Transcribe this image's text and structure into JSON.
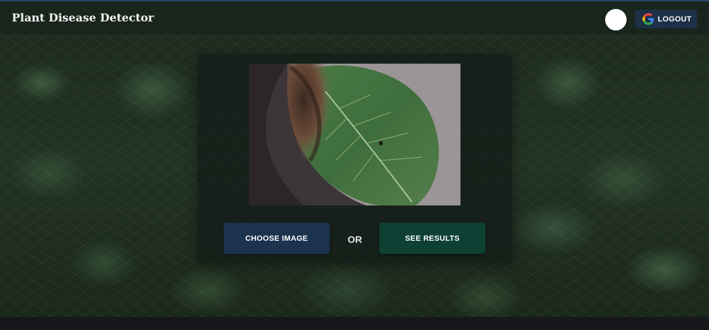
{
  "app": {
    "title": "Plant Disease Detector"
  },
  "navbar": {
    "logout_label": "LOGOUT",
    "logout_icon": "google-g-icon",
    "avatar_color": "#ffffff"
  },
  "upload": {
    "preview_subject": "leaf-image",
    "choose_label": "CHOOSE IMAGE",
    "or_label": "OR",
    "results_label": "SEE RESULTS"
  },
  "colors": {
    "navbar_accent": "#2c4470",
    "choose_button": "#1c3350",
    "results_button": "#0e4134",
    "logout_button": "#1d3048"
  }
}
